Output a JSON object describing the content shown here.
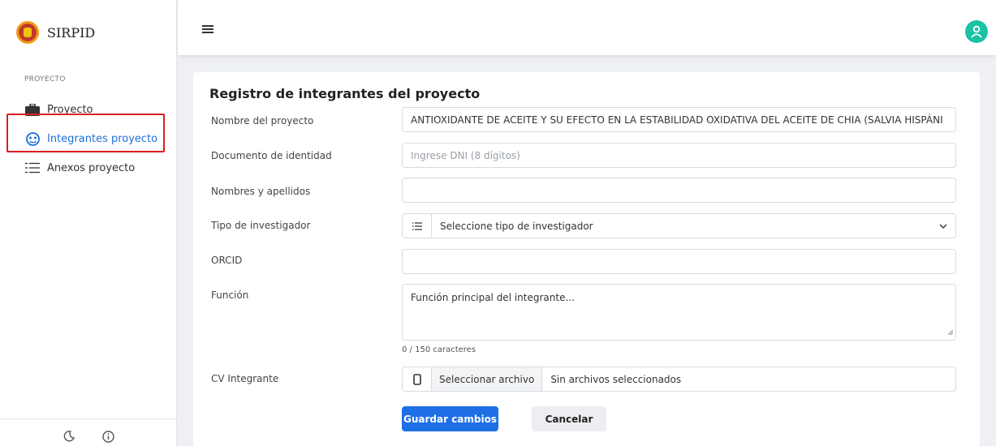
{
  "app": {
    "name": "SIRPID"
  },
  "sidebar": {
    "section": "PROYECTO",
    "items": [
      {
        "label": "Proyecto",
        "icon": "briefcase-icon"
      },
      {
        "label": "Integrantes proyecto",
        "icon": "users-circle-icon",
        "active": true
      },
      {
        "label": "Anexos proyecto",
        "icon": "list-icon"
      }
    ],
    "bottom_icons": [
      "moon-icon",
      "info-icon"
    ]
  },
  "form": {
    "title": "Registro de integrantes del proyecto",
    "project_name": {
      "label": "Nombre del proyecto",
      "value": "ANTIOXIDANTE DE ACEITE Y SU EFECTO EN LA ESTABILIDAD OXIDATIVA DEL ACEITE DE CHIA (SALVIA HISPÁNI"
    },
    "dni": {
      "label": "Documento de identidad",
      "placeholder": "Ingrese DNI (8 dígitos)"
    },
    "full_name": {
      "label": "Nombres y apellidos",
      "value": ""
    },
    "researcher_type": {
      "label": "Tipo de investigador",
      "selected": "Seleccione tipo de investigador"
    },
    "orcid": {
      "label": "ORCID",
      "value": ""
    },
    "role": {
      "label": "Función",
      "placeholder": "Función principal del integrante...",
      "counter": "0 / 150 caracteres"
    },
    "cv": {
      "label": "CV Integrante",
      "button": "Seleccionar archivo",
      "status": "Sin archivos seleccionados"
    },
    "save_label": "Guardar cambios",
    "cancel_label": "Cancelar"
  },
  "colors": {
    "primary": "#1e6fe6",
    "active_nav": "#1e6fd9",
    "highlight": "#e01b24",
    "avatar": "#19c3a4"
  }
}
